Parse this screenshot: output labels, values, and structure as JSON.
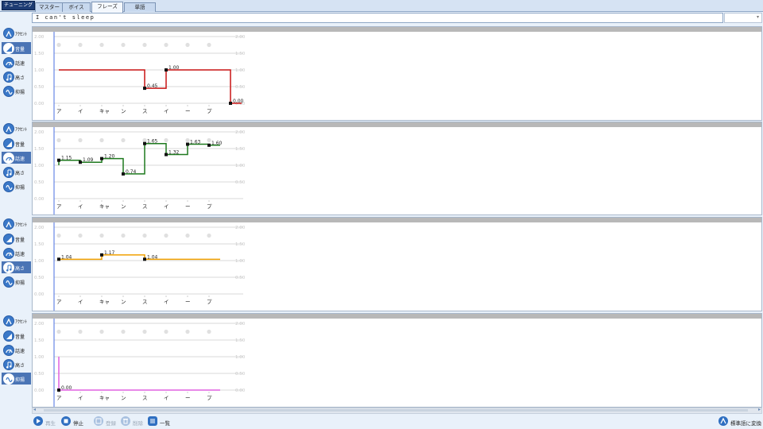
{
  "app": {
    "mode_label": "チューニング",
    "tabs": [
      {
        "label": "マスター"
      },
      {
        "label": "ボイス"
      },
      {
        "label": "フレーズ",
        "active": true
      },
      {
        "label": "単語"
      }
    ]
  },
  "phrase_text": "I can't sleep",
  "sidebar_labels": [
    "ｱｸｾﾝﾄ",
    "音量",
    "話速",
    "高さ",
    "抑揚"
  ],
  "panels": [
    {
      "name": "volume",
      "active_index": 1,
      "color": "#c81414",
      "yticks": [
        "2.00",
        "1.50",
        "1.00",
        "0.50",
        "0.00"
      ],
      "points": [
        {
          "v": 1.0,
          "label": ""
        },
        {
          "v": 1.0,
          "label": ""
        },
        {
          "v": 1.0,
          "label": ""
        },
        {
          "v": 1.0,
          "label": ""
        },
        {
          "v": 0.45,
          "label": "0.45"
        },
        {
          "v": 1.0,
          "label": "1.00"
        },
        {
          "v": 1.0,
          "label": ""
        },
        {
          "v": 1.0,
          "label": ""
        },
        {
          "v": 0.0,
          "label": "0.00"
        }
      ],
      "end_value": 1.0
    },
    {
      "name": "speed",
      "active_index": 2,
      "color": "#1f7a1f",
      "yticks": [
        "2.00",
        "1.50",
        "1.00",
        "0.50"
      ],
      "points": [
        {
          "v": 1.15,
          "label": "1.15"
        },
        {
          "v": 1.09,
          "label": "1.09"
        },
        {
          "v": 1.2,
          "label": "1.20"
        },
        {
          "v": 0.74,
          "label": "0.74"
        },
        {
          "v": 1.65,
          "label": "1.65"
        },
        {
          "v": 1.32,
          "label": "1.32"
        },
        {
          "v": 1.63,
          "label": "1.63"
        },
        {
          "v": 1.6,
          "label": "1.60"
        }
      ],
      "end_value": 1.6
    },
    {
      "name": "pitch",
      "active_index": 3,
      "color": "#f0a000",
      "yticks": [
        "2.00",
        "1.50",
        "1.00",
        "0.50"
      ],
      "points": [
        {
          "v": 1.04,
          "label": "1.04"
        },
        {
          "v": 1.04,
          "label": ""
        },
        {
          "v": 1.17,
          "label": "1.17"
        },
        {
          "v": 1.17,
          "label": ""
        },
        {
          "v": 1.04,
          "label": "1.04"
        },
        {
          "v": 1.04,
          "label": ""
        },
        {
          "v": 1.04,
          "label": ""
        },
        {
          "v": 1.04,
          "label": ""
        }
      ],
      "end_value": 1.04
    },
    {
      "name": "intonation",
      "active_index": 4,
      "color": "#e060e0",
      "yticks": [
        "2.00",
        "1.50",
        "1.00",
        "0.50",
        "0.00"
      ],
      "points": [
        {
          "v": 0.0,
          "label": "0.00"
        },
        {
          "v": 0.0,
          "label": ""
        },
        {
          "v": 0.0,
          "label": ""
        },
        {
          "v": 0.0,
          "label": ""
        },
        {
          "v": 0.0,
          "label": ""
        },
        {
          "v": 0.0,
          "label": ""
        },
        {
          "v": 0.0,
          "label": ""
        },
        {
          "v": 0.0,
          "label": ""
        }
      ],
      "end_value": 0.0
    }
  ],
  "moras": [
    "ア",
    "イ",
    "キャ",
    "ン",
    "ス",
    "イ",
    "ー",
    "プ"
  ],
  "bottom": {
    "play": "再生",
    "stop": "停止",
    "register": "登録",
    "delete": "削除",
    "list": "一覧",
    "convert": "標準語に変換"
  },
  "colors": {
    "accent": "#2f6fc1",
    "sidebar_active": "#4a74b5",
    "cursor_line": "#4a6fe0",
    "tuning_label_bg": "#1d3c73"
  }
}
